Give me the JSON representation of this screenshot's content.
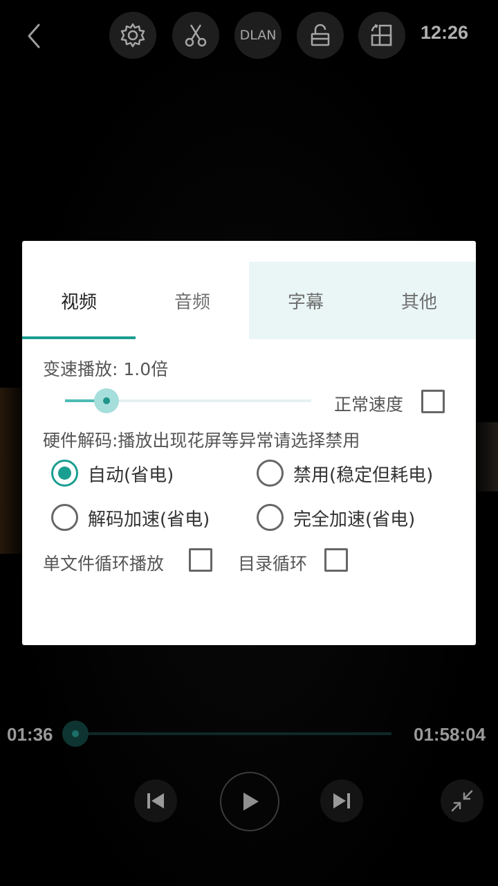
{
  "top_bar": {
    "dlan_label": "DLAN",
    "clock": "12:26"
  },
  "dialog": {
    "tabs": [
      {
        "label": "视频",
        "active": true
      },
      {
        "label": "音频",
        "active": false
      },
      {
        "label": "字幕",
        "active": false
      },
      {
        "label": "其他",
        "active": false
      }
    ],
    "speed": {
      "label": "变速播放: 1.0倍",
      "slider_value": 1.0,
      "normal_speed_label": "正常速度",
      "normal_speed_checked": false
    },
    "hw_decode": {
      "label": "硬件解码:播放出现花屏等异常请选择禁用",
      "options": [
        {
          "label": "自动(省电)",
          "selected": true
        },
        {
          "label": "禁用(稳定但耗电)",
          "selected": false
        },
        {
          "label": "解码加速(省电)",
          "selected": false
        },
        {
          "label": "完全加速(省电)",
          "selected": false
        }
      ]
    },
    "loop": {
      "single_file_label": "单文件循环播放",
      "single_file_checked": false,
      "folder_label": "目录循环",
      "folder_checked": false
    }
  },
  "playback": {
    "current_time": "01:36",
    "total_time": "01:58:04",
    "progress_fraction": 0.0136
  },
  "colors": {
    "accent": "#1a9e90",
    "tab_tint": "#e9f6f5"
  }
}
